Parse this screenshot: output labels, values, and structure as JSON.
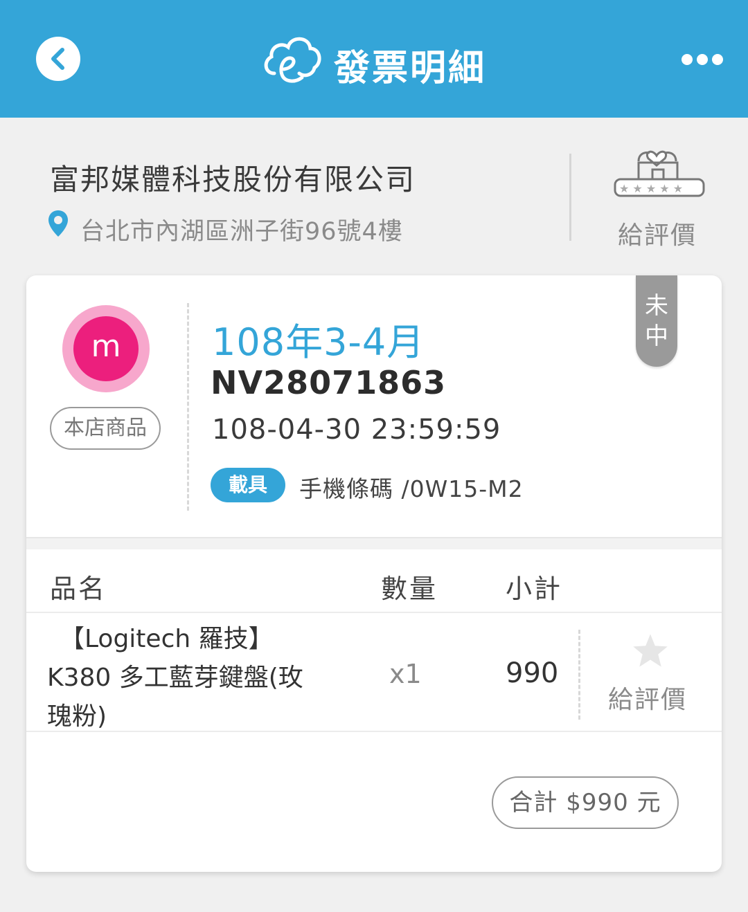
{
  "header": {
    "title": "發票明細",
    "back_icon": "chevron-left-icon",
    "logo_icon": "cloud-e-logo-icon",
    "more_icon": "more-dots-icon"
  },
  "store": {
    "name": "富邦媒體科技股份有限公司",
    "address": "台北市內湖區洲子街96號4樓",
    "rate_label": "給評價",
    "rate_icon": "store-rating-icon"
  },
  "invoice": {
    "avatar_letter": "m",
    "store_tag": "本店商品",
    "period": "108年3-4月",
    "number": "NV28071863",
    "datetime": "108-04-30 23:59:59",
    "carrier_badge": "載具",
    "carrier_text": "手機條碼 /0W15-M2",
    "lottery_status": "未中"
  },
  "table": {
    "headers": {
      "name": "品名",
      "qty": "數量",
      "subtotal": "小計"
    },
    "rows": [
      {
        "name_line1": "【Logitech 羅技】",
        "name_line2": "K380 多工藍芽鍵盤(玫",
        "name_line3": "瑰粉)",
        "qty": "x1",
        "subtotal": "990",
        "rate_label": "給評價"
      }
    ]
  },
  "total": {
    "label": "合計 $990 元"
  },
  "colors": {
    "primary": "#34a5d8",
    "avatar_pink": "#ec1f7d",
    "avatar_ring": "#f7a7cc",
    "ribbon_gray": "#9a9a9a"
  }
}
